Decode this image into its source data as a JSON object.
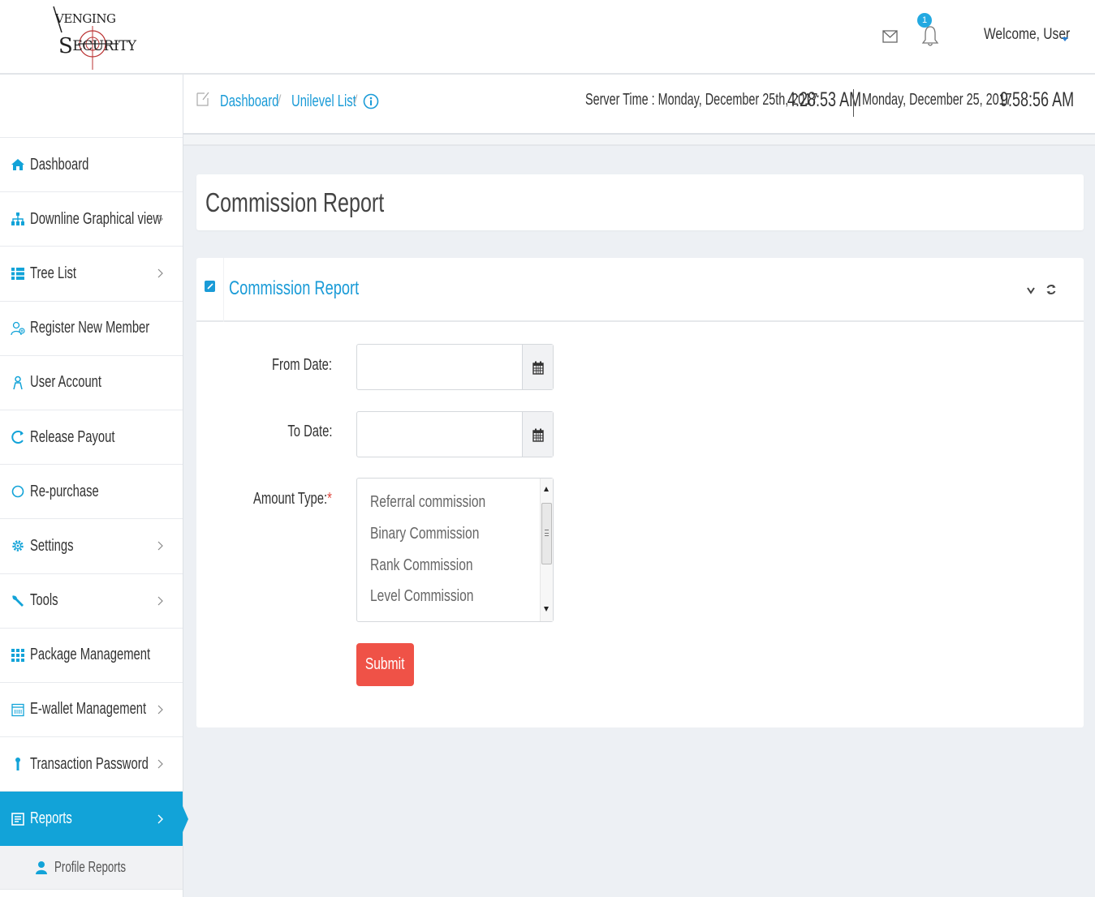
{
  "logo": {
    "line1": "VENGING",
    "line2": "ECURITY"
  },
  "header": {
    "notification_count": "1",
    "welcome": "Welcome, User"
  },
  "colors": {
    "accent": "#12a3d8",
    "link": "#1a9bd7",
    "submit": "#ef5247"
  },
  "sidebar": {
    "items": [
      {
        "label": "Dashboard",
        "icon": "home-icon",
        "chevron": false
      },
      {
        "label": "Downline Graphical view",
        "icon": "sitemap-icon",
        "chevron": true
      },
      {
        "label": "Tree List",
        "icon": "list-icon",
        "chevron": true
      },
      {
        "label": "Register New Member",
        "icon": "user-add-icon",
        "chevron": false
      },
      {
        "label": "User Account",
        "icon": "user-icon",
        "chevron": false
      },
      {
        "label": "Release Payout",
        "icon": "refresh-icon",
        "chevron": false
      },
      {
        "label": "Re-purchase",
        "icon": "circle-icon",
        "chevron": false
      },
      {
        "label": "Settings",
        "icon": "gear-icon",
        "chevron": true
      },
      {
        "label": "Tools",
        "icon": "wrench-icon",
        "chevron": true
      },
      {
        "label": "Package Management",
        "icon": "grid-icon",
        "chevron": false
      },
      {
        "label": "E-wallet Management",
        "icon": "calendar-icon",
        "chevron": true
      },
      {
        "label": "Transaction Password",
        "icon": "key-icon",
        "chevron": true
      },
      {
        "label": "Reports",
        "icon": "report-icon",
        "chevron": true,
        "active": true
      }
    ],
    "submenu": [
      {
        "label": "Profile Reports",
        "icon": "person-icon"
      }
    ]
  },
  "breadcrumb": {
    "items": [
      "Dashboard",
      "Unilevel List"
    ],
    "separator": "/"
  },
  "server_time": {
    "label": "Server Time : Monday, December 25th, 2017",
    "time": "4:28:53 AM",
    "local_date": "Monday, December 25, 2017",
    "local_time": "9:58:56 AM"
  },
  "page": {
    "title": "Commission Report"
  },
  "form": {
    "title": "Commission Report",
    "from_date_label": "From Date:",
    "from_date_value": "",
    "to_date_label": "To Date:",
    "to_date_value": "",
    "amount_type_label": "Amount Type:",
    "required_mark": "*",
    "amount_type_options": [
      "Referral commission",
      "Binary Commission",
      "Rank Commission",
      "Level Commission"
    ],
    "submit_label": "Submit"
  }
}
